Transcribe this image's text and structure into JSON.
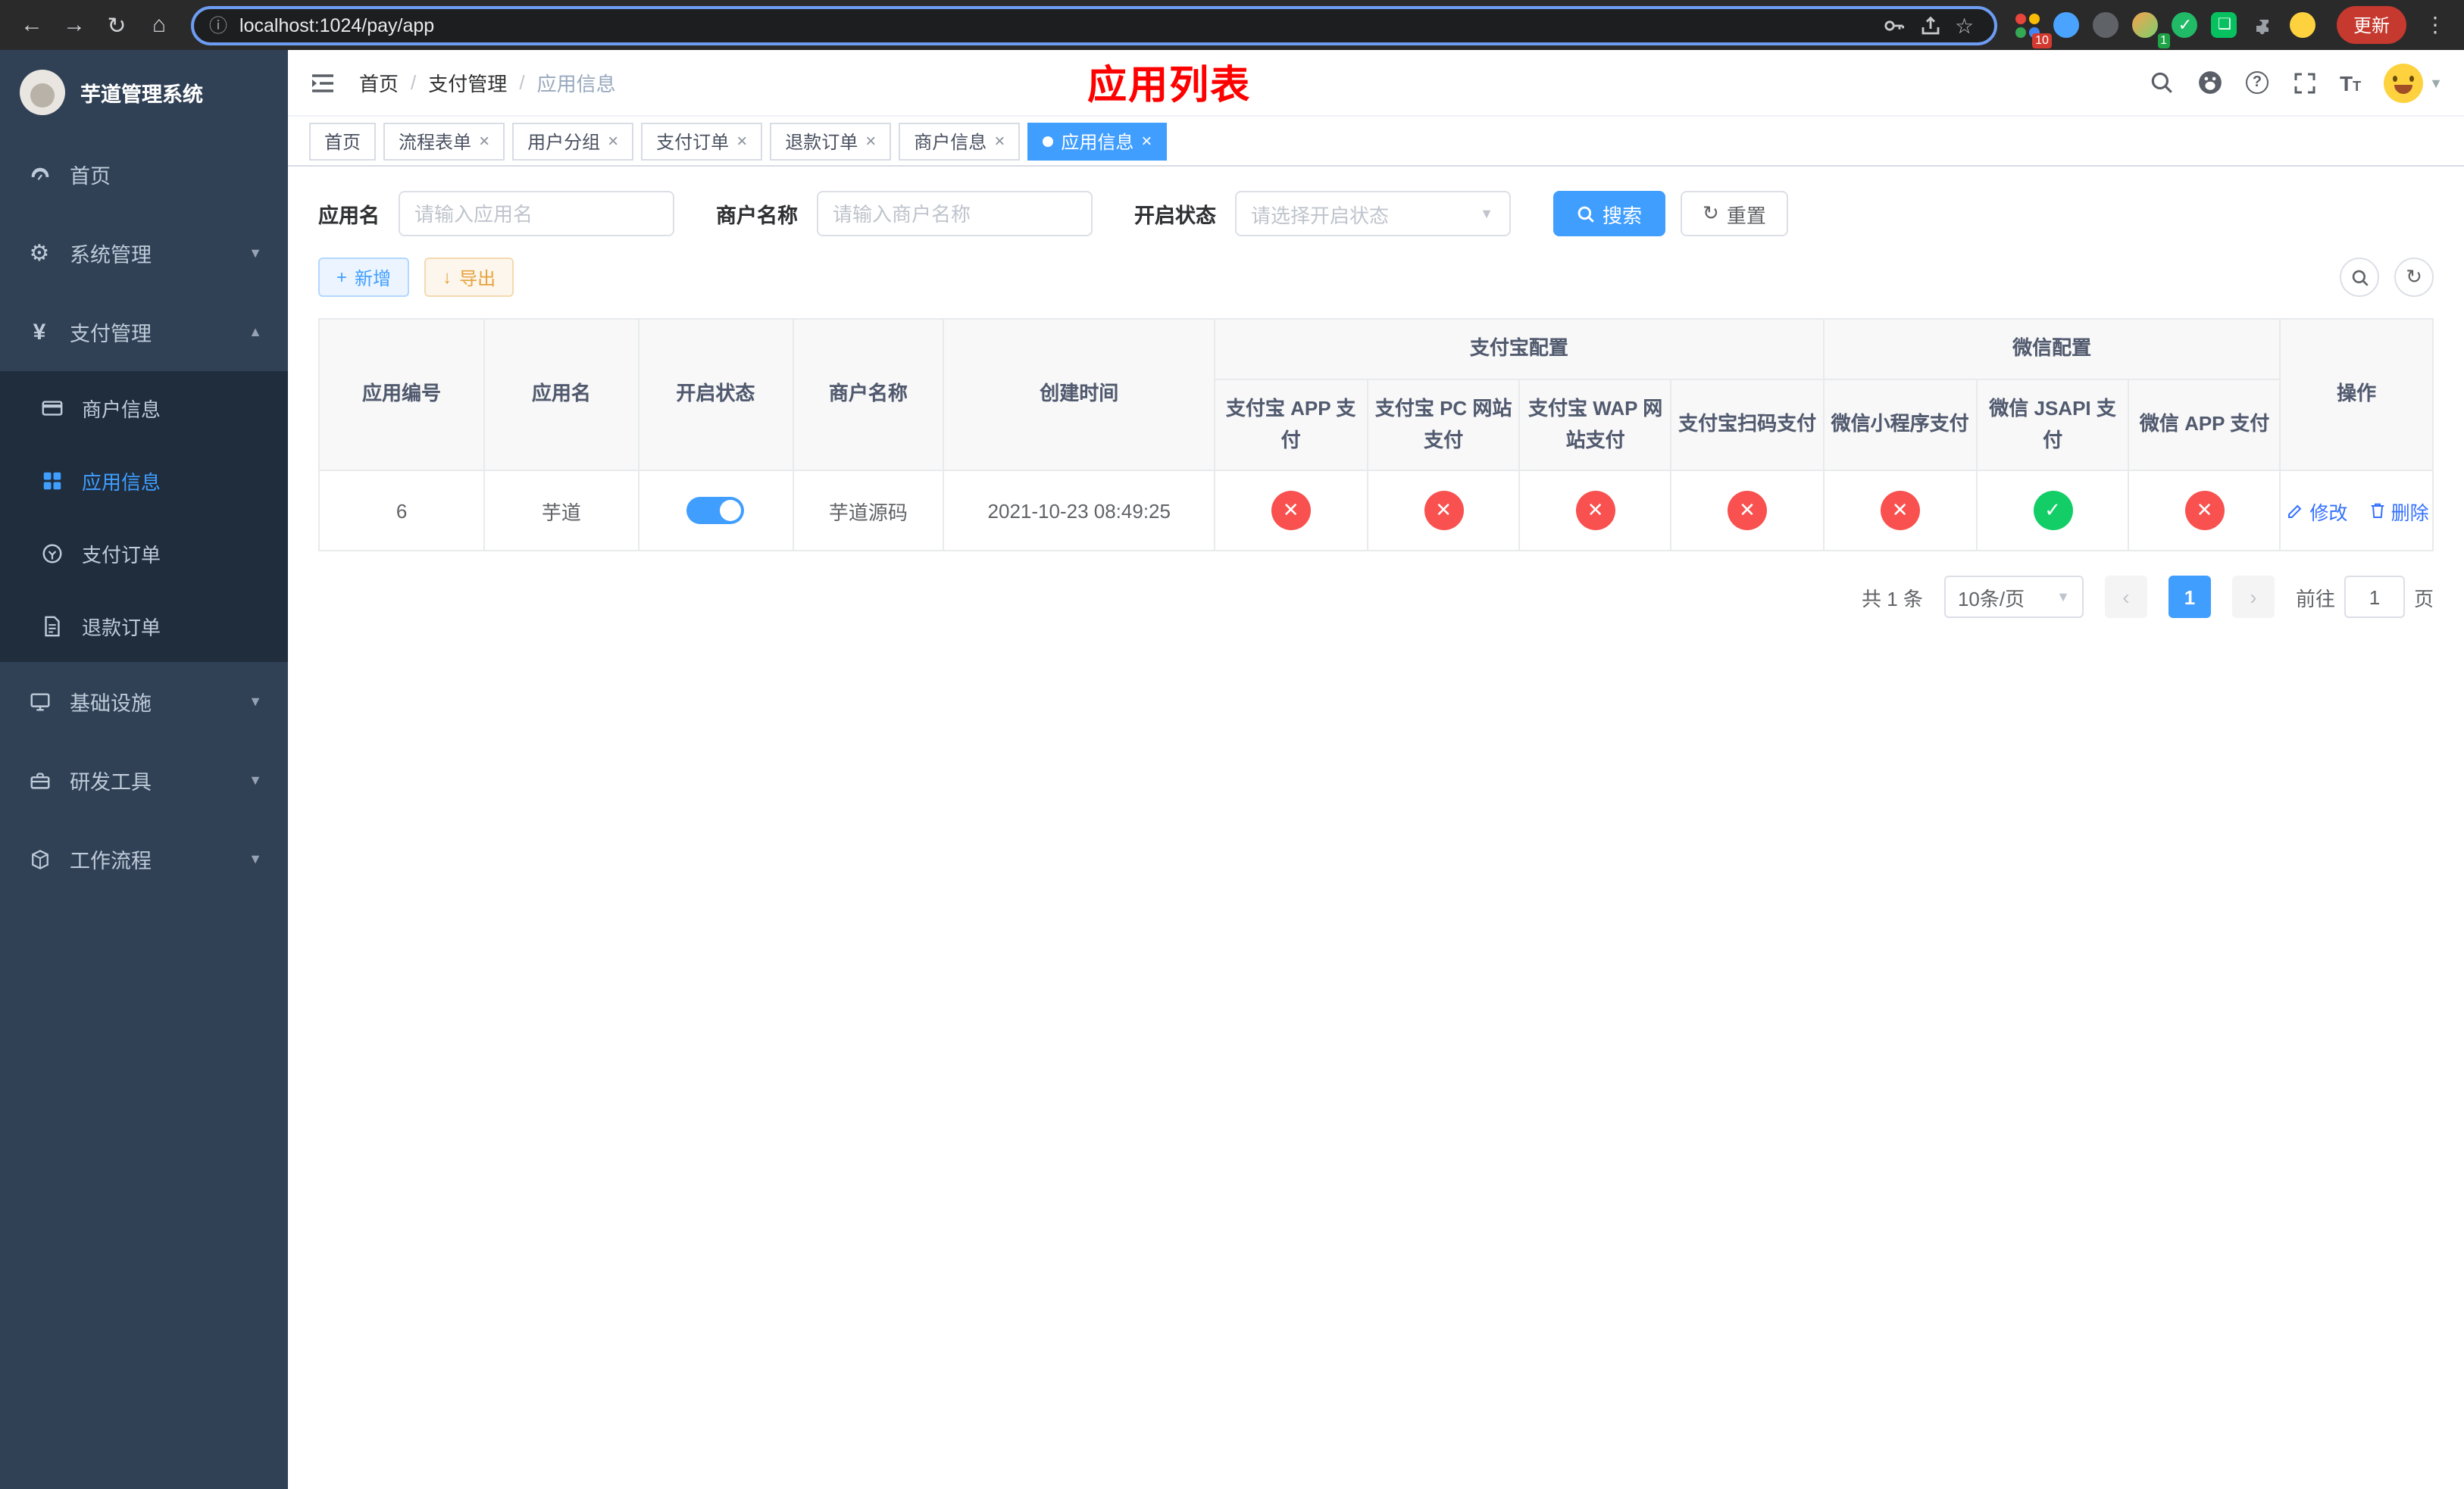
{
  "browser": {
    "url": "localhost:1024/pay/app",
    "update_label": "更新",
    "extension_badges": {
      "grid": "10",
      "avatar": "1"
    }
  },
  "sidebar": {
    "logo_title": "芋道管理系统",
    "items": [
      {
        "label": "首页"
      },
      {
        "label": "系统管理"
      },
      {
        "label": "支付管理"
      },
      {
        "label": "基础设施"
      },
      {
        "label": "研发工具"
      },
      {
        "label": "工作流程"
      }
    ],
    "payment_children": [
      {
        "label": "商户信息"
      },
      {
        "label": "应用信息"
      },
      {
        "label": "支付订单"
      },
      {
        "label": "退款订单"
      }
    ]
  },
  "header": {
    "breadcrumb": [
      "首页",
      "支付管理",
      "应用信息"
    ],
    "page_title": "应用列表"
  },
  "tabs": [
    {
      "label": "首页"
    },
    {
      "label": "流程表单"
    },
    {
      "label": "用户分组"
    },
    {
      "label": "支付订单"
    },
    {
      "label": "退款订单"
    },
    {
      "label": "商户信息"
    },
    {
      "label": "应用信息"
    }
  ],
  "filters": {
    "app_name_label": "应用名",
    "app_name_placeholder": "请输入应用名",
    "merchant_label": "商户名称",
    "merchant_placeholder": "请输入商户名称",
    "status_label": "开启状态",
    "status_placeholder": "请选择开启状态",
    "search_button": "搜索",
    "reset_button": "重置"
  },
  "toolbar": {
    "add_button": "新增",
    "export_button": "导出"
  },
  "table": {
    "col_app_id": "应用编号",
    "col_app_name": "应用名",
    "col_status": "开启状态",
    "col_merchant": "商户名称",
    "col_created": "创建时间",
    "group_alipay": "支付宝配置",
    "group_wechat": "微信配置",
    "alipay_cols": [
      "支付宝 APP 支付",
      "支付宝 PC 网站支付",
      "支付宝 WAP 网站支付",
      "支付宝扫码支付"
    ],
    "wechat_cols": [
      "微信小程序支付",
      "微信 JSAPI 支付",
      "微信 APP 支付"
    ],
    "col_ops": "操作",
    "rows": [
      {
        "id": "6",
        "app_name": "芋道",
        "status_on": true,
        "merchant": "芋道源码",
        "created_at": "2021-10-23 08:49:25",
        "channels": [
          "no",
          "no",
          "no",
          "no",
          "no",
          "yes",
          "no"
        ],
        "edit_label": "修改",
        "delete_label": "删除"
      }
    ]
  },
  "pagination": {
    "total": "共 1 条",
    "page_size": "10条/页",
    "page": "1",
    "goto_label": "前往",
    "goto_value": "1",
    "goto_unit": "页"
  }
}
